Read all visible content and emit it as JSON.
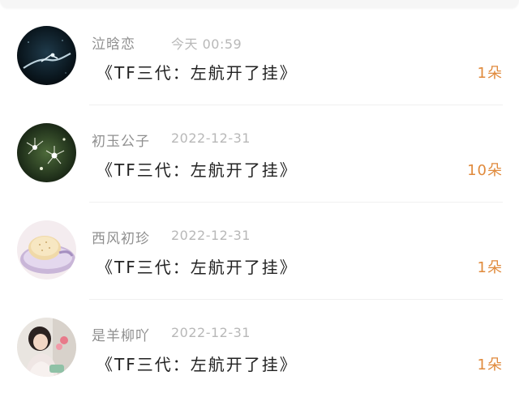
{
  "colors": {
    "username": "#8f8f8f",
    "timestamp": "#b8b8b8",
    "title": "#222222",
    "count_accent": "#e08a3c",
    "divider": "#f0f0f0"
  },
  "entries": [
    {
      "avatar_icon": "night-sky-figure-avatar",
      "username": "泣晗恋",
      "time": "今天 00:59",
      "title": "《TF三代：左航开了挂》",
      "count": "1朵"
    },
    {
      "avatar_icon": "dandelion-sparkle-avatar",
      "username": "初玉公子",
      "time": "2022-12-31",
      "title": "《TF三代：左航开了挂》",
      "count": "10朵"
    },
    {
      "avatar_icon": "bread-plate-avatar",
      "username": "西风初珍",
      "time": "2022-12-31",
      "title": "《TF三代：左航开了挂》",
      "count": "1朵"
    },
    {
      "avatar_icon": "child-photo-avatar",
      "username": "是羊柳吖",
      "time": "2022-12-31",
      "title": "《TF三代：左航开了挂》",
      "count": "1朵"
    }
  ]
}
